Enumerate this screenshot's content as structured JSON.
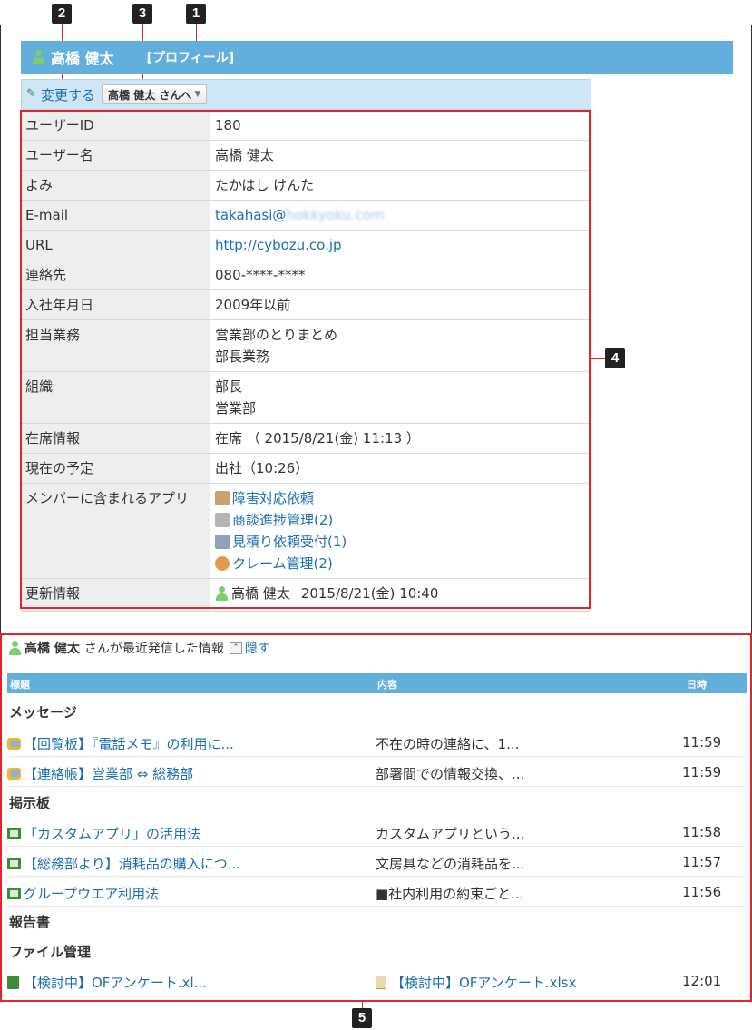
{
  "callouts": [
    "1",
    "2",
    "3",
    "4",
    "5"
  ],
  "header": {
    "user_name": "高橋 健太",
    "profile_label": "[プロフィール]"
  },
  "toolbar": {
    "edit_label": "変更する",
    "user_menu_label": "高橋 健太 さんへ"
  },
  "profile": {
    "user_id": {
      "key": "ユーザーID",
      "value": "180"
    },
    "user_name": {
      "key": "ユーザー名",
      "value": "高橋 健太"
    },
    "reading": {
      "key": "よみ",
      "value": "たかはし けんた"
    },
    "email": {
      "key": "E-mail",
      "value_prefix": "takahasi@",
      "value_blurred": "hokkyoku.com"
    },
    "url": {
      "key": "URL",
      "value": "http://cybozu.co.jp"
    },
    "contact": {
      "key": "連絡先",
      "value": "080-****-****"
    },
    "join_date": {
      "key": "入社年月日",
      "value": "2009年以前"
    },
    "duties": {
      "key": "担当業務",
      "line1": "営業部のとりまとめ",
      "line2": "部長業務"
    },
    "organization": {
      "key": "組織",
      "line1": "部長",
      "line2": "営業部"
    },
    "presence": {
      "key": "在席情報",
      "value": "在席 （ 2015/8/21(金) 11:13 ）"
    },
    "schedule": {
      "key": "現在の予定",
      "value": "出社（10:26）"
    },
    "apps": {
      "key": "メンバーに含まれるアプリ",
      "items": [
        {
          "label": "障害対応依頼",
          "color": "#c9a36b"
        },
        {
          "label": "商談進捗管理(2)",
          "color": "#b5b5b5"
        },
        {
          "label": "見積り依頼受付(1)",
          "color": "#8fa3b8"
        },
        {
          "label": "クレーム管理(2)",
          "color": "#e39a4c"
        }
      ]
    },
    "updated": {
      "key": "更新情報",
      "user": "高橋 健太",
      "datetime": "2015/8/21(金) 10:40"
    }
  },
  "recent": {
    "user_name": "高橋 健太",
    "suffix": "さんが最近発信した情報",
    "hide_label": "隠す",
    "columns": {
      "title": "標題",
      "content": "内容",
      "date": "日時"
    },
    "categories": {
      "message": "メッセージ",
      "bulletin": "掲示板",
      "report": "報告書",
      "file": "ファイル管理"
    },
    "messages": [
      {
        "title": "【回覧板】『電話メモ』の利用に...",
        "content": "不在の時の連絡に、1...",
        "time": "11:59"
      },
      {
        "title": "【連絡帳】営業部 ⇔ 総務部",
        "content": "部署間での情報交換、...",
        "time": "11:59"
      }
    ],
    "bulletins": [
      {
        "title": "「カスタムアプリ」の活用法",
        "content": "カスタムアプリという...",
        "time": "11:58"
      },
      {
        "title": "【総務部より】消耗品の購入につ...",
        "content": "文房具などの消耗品を...",
        "time": "11:57"
      },
      {
        "title": "グループウエア利用法",
        "content": "■社内利用の約束ごと...",
        "time": "11:56"
      }
    ],
    "files": [
      {
        "title": "【検討中】OFアンケート.xl...",
        "content": "【検討中】OFアンケート.xlsx",
        "time": "12:01"
      }
    ]
  },
  "colors": {
    "accent": "#62aedc",
    "toolbar_bg": "#cfe6f6",
    "link": "#1a6fb3",
    "annotation_red": "#e0262c"
  }
}
